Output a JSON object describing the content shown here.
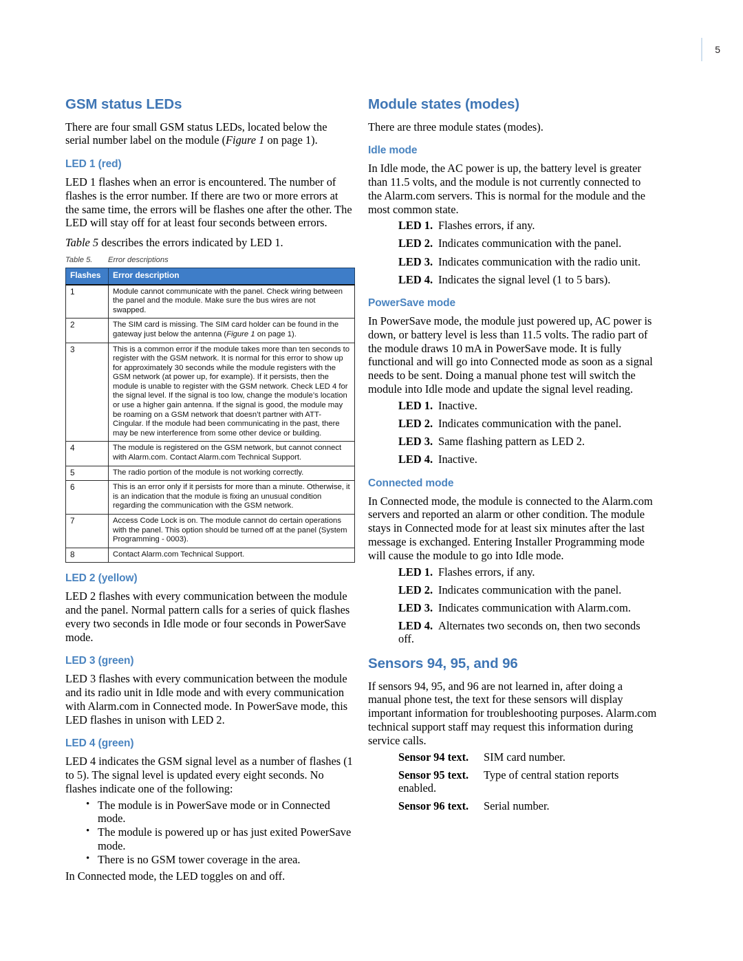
{
  "page": {
    "folio": "5"
  },
  "left_column": {
    "heading": "GSM status LEDs",
    "intro": "There are four small GSM status LEDs, located below the serial number label on the module (Figure 1 on page 1).",
    "intro_parts": {
      "a": "There are four small GSM status LEDs, located below the serial number label on the module (",
      "italic": "Figure 1",
      "b": " on page 1)."
    },
    "led1": {
      "heading": "LED 1 (red)",
      "para": "LED 1 flashes when an error is encountered. The number of flashes is the error number. If there are two or more errors at the same time, the errors will be flashes one after the other. The LED will stay off for at least four seconds between errors.",
      "table_ref_italic": "Table 5",
      "table_ref_rest": " describes the errors indicated by LED 1."
    },
    "table": {
      "caption_number": "Table 5.",
      "caption_title": "Error descriptions",
      "columns": [
        "Flashes",
        "Error description"
      ],
      "rows": [
        {
          "flashes": "1",
          "description": "Module cannot communicate with the panel. Check wiring between the panel and the module. Make sure the bus wires are not swapped."
        },
        {
          "flashes": "2",
          "description_a": "The SIM card is missing. The SIM card holder can be found in the gateway just below the antenna (",
          "description_italic": "Figure 1",
          "description_b": " on page 1)."
        },
        {
          "flashes": "3",
          "description": "This is a common error if the module takes more than ten seconds to register with the GSM network. It is normal for this error to show up for approximately 30 seconds while the module registers with the GSM network (at power up, for example). If it persists, then the module is unable to register with the GSM network. Check LED 4 for the signal level. If the signal is too low, change the module’s location or use a higher gain antenna. If the signal is good, the module may be roaming on a GSM network that doesn’t partner with ATT-Cingular. If the module had been communicating in the past, there may be new interference from some other device or building."
        },
        {
          "flashes": "4",
          "description": "The module is registered on the GSM network, but cannot connect with Alarm.com. Contact Alarm.com Technical Support."
        },
        {
          "flashes": "5",
          "description": "The radio portion of the module is not working correctly."
        },
        {
          "flashes": "6",
          "description": "This is an error only if it persists for more than a minute. Otherwise, it is an indication that the module is fixing an unusual condition regarding the communication with the GSM network."
        },
        {
          "flashes": "7",
          "description": "Access Code Lock is on. The module cannot do certain operations with the panel. This option should be turned off at the panel (System Programming - 0003)."
        },
        {
          "flashes": "8",
          "description": "Contact Alarm.com Technical Support."
        }
      ]
    },
    "led2": {
      "heading": "LED 2 (yellow)",
      "para": "LED 2 flashes with every communication between the module and the panel. Normal pattern calls for a series of quick flashes every two seconds in Idle mode or four seconds in PowerSave mode."
    },
    "led3": {
      "heading": "LED 3 (green)",
      "para": "LED 3 flashes with every communication between the module and its radio unit in Idle mode and with every communication with Alarm.com in Connected mode. In PowerSave mode, this LED flashes in unison with LED 2."
    },
    "led4": {
      "heading": "LED 4 (green)",
      "para": "LED 4 indicates the GSM signal level as a number of flashes (1 to 5). The signal level is updated every eight seconds. No flashes indicate one of the following:",
      "bullets": [
        "The module is in PowerSave mode or in Connected mode.",
        "The module is powered up or has just exited PowerSave mode.",
        "There is no GSM tower coverage in the area."
      ],
      "closing": "In Connected mode, the LED toggles on and off."
    }
  },
  "right_column": {
    "heading": "Module states (modes)",
    "intro": "There are three module states (modes).",
    "idle": {
      "heading": "Idle mode",
      "para": "In Idle mode, the AC power is up, the battery level is greater than 11.5 volts, and the module is not currently connected to the Alarm.com servers. This is normal for the module and the most common state.",
      "leds": [
        {
          "label": "LED 1.",
          "text": "Flashes errors, if any."
        },
        {
          "label": "LED 2.",
          "text": "Indicates communication with the panel."
        },
        {
          "label": "LED 3.",
          "text": "Indicates communication with the radio unit."
        },
        {
          "label": "LED 4.",
          "text": "Indicates the signal level (1 to 5 bars)."
        }
      ]
    },
    "powersave": {
      "heading": "PowerSave mode",
      "para": "In PowerSave mode, the module just powered up, AC power is down, or battery level is less than 11.5 volts. The radio part of the module draws 10 mA in PowerSave mode. It is fully functional and will go into Connected mode as soon as a signal needs to be sent. Doing a manual phone test will switch the module into Idle mode and update the signal level reading.",
      "leds": [
        {
          "label": "LED 1.",
          "text": "Inactive."
        },
        {
          "label": "LED 2.",
          "text": "Indicates communication with the panel."
        },
        {
          "label": "LED 3.",
          "text": "Same flashing pattern as LED 2."
        },
        {
          "label": "LED 4.",
          "text": "Inactive."
        }
      ]
    },
    "connected": {
      "heading": "Connected mode",
      "para": "In Connected mode, the module is connected to the Alarm.com servers and reported an alarm or other condition. The module stays in Connected mode for at least six minutes after the last message is exchanged. Entering Installer Programming mode will cause the module to go into Idle mode.",
      "leds": [
        {
          "label": "LED 1.",
          "text": "Flashes errors, if any."
        },
        {
          "label": "LED 2.",
          "text": "Indicates communication with the panel."
        },
        {
          "label": "LED 3.",
          "text": "Indicates communication with Alarm.com."
        },
        {
          "label": "LED 4.",
          "text": "Alternates two seconds on, then two seconds off."
        }
      ]
    },
    "sensors": {
      "heading": "Sensors 94, 95, and 96",
      "para": "If sensors 94, 95, and 96 are not learned in, after doing a manual phone test, the text for these sensors will display important information for troubleshooting purposes. Alarm.com technical support staff may request this information during service calls.",
      "items": [
        {
          "label": "Sensor 94 text.",
          "text": "SIM card number."
        },
        {
          "label": "Sensor 95 text.",
          "text": "Type of central station reports enabled."
        },
        {
          "label": "Sensor 96 text.",
          "text": "Serial number."
        }
      ]
    }
  },
  "colors": {
    "heading_blue": "#3f76b5",
    "subheading_blue": "#4a84c0",
    "table_header_blue": "#3e7dc8",
    "folio_rule": "#cfe0ef"
  }
}
